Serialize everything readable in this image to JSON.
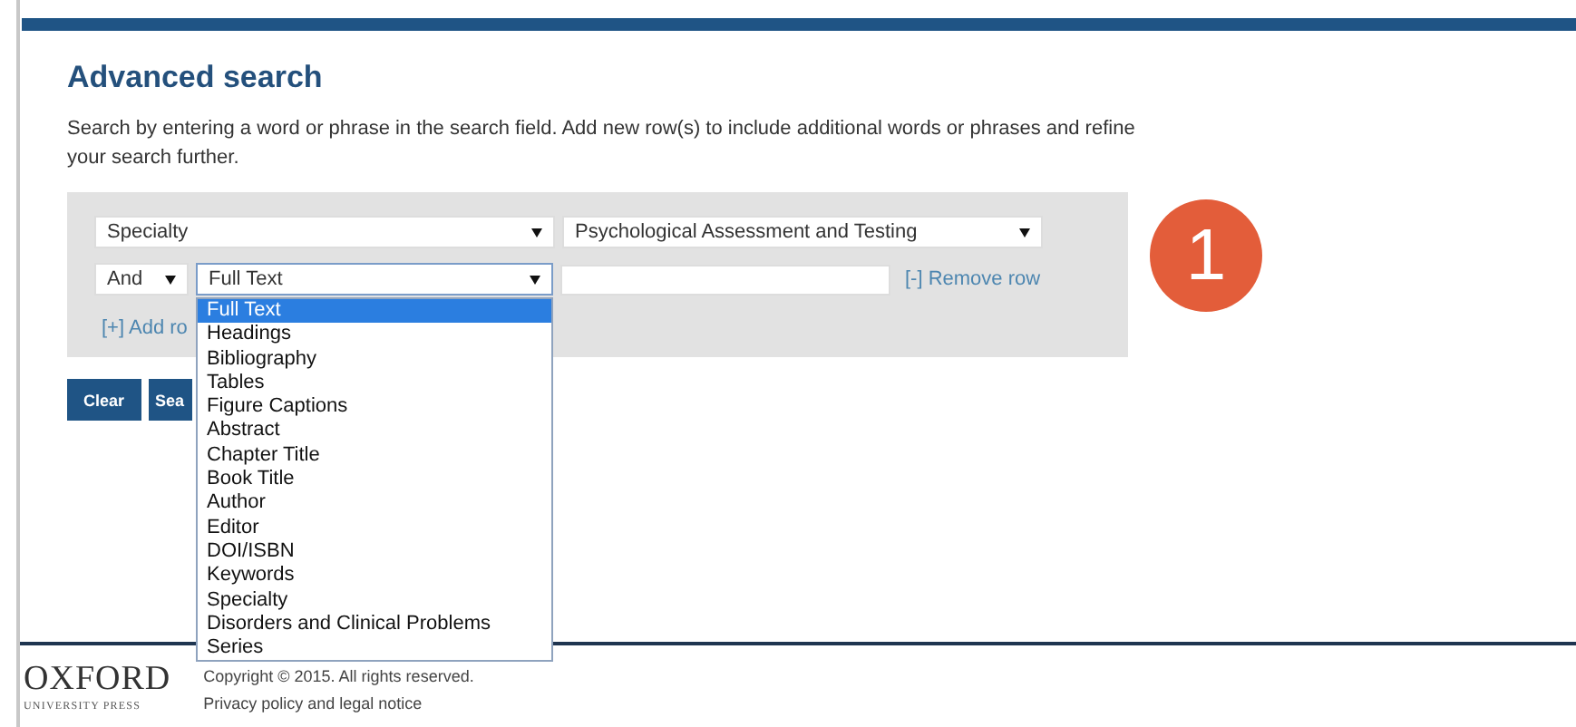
{
  "heading": "Advanced search",
  "description": "Search by entering a word or phrase in the search field. Add new row(s) to include additional words or phrases and refine your search further.",
  "rows": [
    {
      "operator": null,
      "field": "Specialty",
      "value_select": "Psychological Assessment and Testing"
    },
    {
      "operator": "And",
      "field": "Full Text",
      "field_focused": true,
      "remove_link": "[-] Remove row"
    }
  ],
  "add_row_link": "[+] Add ro",
  "buttons": [
    "Clear",
    "Sea"
  ],
  "dropdown": {
    "options": [
      {
        "label": "Full Text",
        "selected": true
      },
      {
        "label": "Headings",
        "selected": false
      },
      {
        "label": "Bibliography",
        "selected": false
      },
      {
        "label": "Tables",
        "selected": false
      },
      {
        "label": "Figure Captions",
        "selected": false
      },
      {
        "label": "Abstract",
        "selected": false
      },
      {
        "label": "Chapter Title",
        "selected": false
      },
      {
        "label": "Book Title",
        "selected": false
      },
      {
        "label": "Author",
        "selected": false
      },
      {
        "label": "Editor",
        "selected": false
      },
      {
        "label": "DOI/ISBN",
        "selected": false
      },
      {
        "label": "Keywords",
        "selected": false
      },
      {
        "label": "Specialty",
        "selected": false
      },
      {
        "label": "Disorders and Clinical Problems",
        "selected": false
      },
      {
        "label": "Series",
        "selected": false
      }
    ]
  },
  "step_badge": "1",
  "footer": {
    "logo": "OXFORD",
    "logo_sub": "UNIVERSITY PRESS",
    "copyright": "Copyright © 2015. All rights reserved.",
    "privacy_link": "Privacy policy and legal notice"
  }
}
